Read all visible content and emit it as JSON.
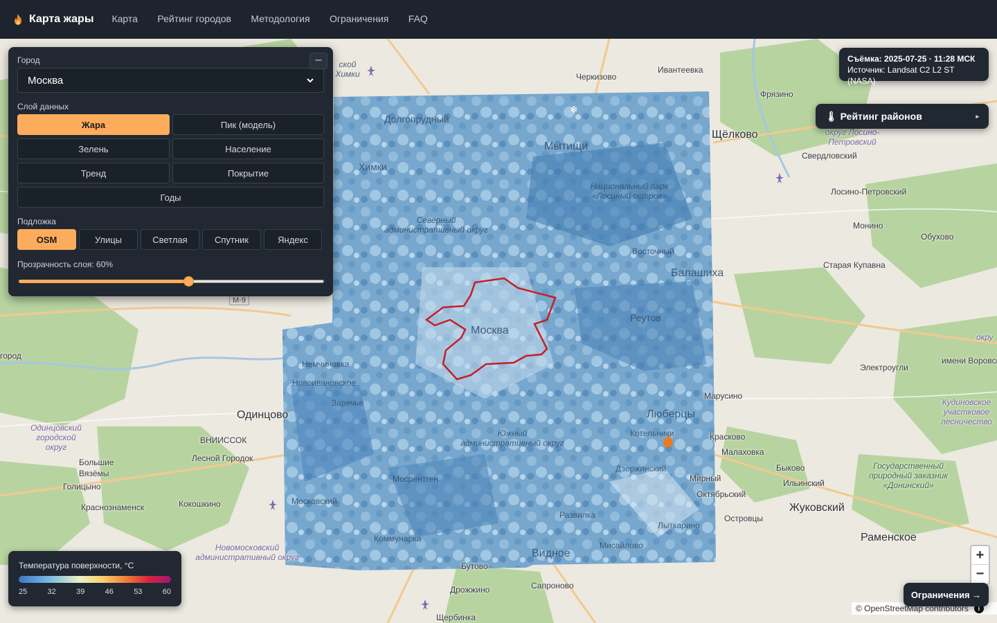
{
  "app": {
    "title": "Карта жары"
  },
  "nav": {
    "items": [
      "Карта",
      "Рейтинг городов",
      "Методология",
      "Ограничения",
      "FAQ"
    ]
  },
  "panel": {
    "city_label": "Город",
    "city_value": "Москва",
    "layer_label": "Слой данных",
    "layers": [
      "Жара",
      "Пик (модель)",
      "Зелень",
      "Население",
      "Тренд",
      "Покрытие",
      "Годы"
    ],
    "active_layer": "Жара",
    "basemap_label": "Подложка",
    "basemaps": [
      "OSM",
      "Улицы",
      "Светлая",
      "Спутник",
      "Яндекс"
    ],
    "active_basemap": "OSM",
    "opacity_label": "Прозрачность слоя: 60%",
    "opacity_value": 0.6,
    "collapse_glyph": "–"
  },
  "info": {
    "capture_label": "Съёмка:",
    "capture_value": "2025-07-25 · 11:28 МСК",
    "source_label": "Источник:",
    "source_value": "Landsat C2 L2 ST (NASA)"
  },
  "ranking": {
    "label": "🌡 Рейтинг районов",
    "arrow": "▸"
  },
  "legend": {
    "title": "Температура поверхности, °C",
    "ticks": [
      "25",
      "32",
      "39",
      "46",
      "53",
      "60"
    ]
  },
  "zoom": {
    "in": "+",
    "out": "−"
  },
  "limits_button": "Ограничения →",
  "attribution": "© OpenStreetMap contributors",
  "attribution_icon": "i",
  "map_labels": {
    "moscow": "Москва",
    "mytishchi": "Мытищи",
    "khimki": "Химки",
    "dolgoprudny": "Долгопрудный",
    "shchyolkovo": "Щёлково",
    "balashikha": "Балашиха",
    "reutov": "Реутов",
    "odintsovo": "Одинцово",
    "lyubertsy": "Люберцы",
    "kotelniki": "Котельники",
    "dzerzhinsky": "Дзержинский",
    "vidnoe": "Видное",
    "zhukovsky": "Жуковский",
    "ramenskoe": "Раменское",
    "cherkizovo": "Черкизово",
    "ivanteevka": "Ивантеевка",
    "fryazino": "Фрязино",
    "sverdlovsky": "Свердловский",
    "losino": "Лосино-Петровский",
    "monino": "Монино",
    "obukhovo": "Обухово",
    "kupavna": "Старая Купавна",
    "elektrougli": "Электроугли",
    "vorovskogo": "имени Воровского",
    "marusino": "Марусино",
    "kraskovo": "Красково",
    "malakhovka": "Малаховка",
    "bykovo": "Быково",
    "ilinsky": "Ильинский",
    "mirny": "Мирный",
    "oktyabrsky": "Октябрьский",
    "ostrovtsy": "Островцы",
    "lytkarino": "Лыткарино",
    "razvilka": "Развилка",
    "misailovo": "Мисайлово",
    "butovo": "Бутово",
    "drozhzhino": "Дрожжино",
    "saprono": "Сапроново",
    "shcherbinka": "Щербинка",
    "kommunarka": "Коммунарка",
    "mosrentgen": "Мосрентген",
    "moskovsky": "Московский",
    "nemchinovka": "Немчиновка",
    "novoivankovskoe": "Новоивановское",
    "zarechye": "Заречье",
    "vniissok": "ВНИИССОК",
    "lesnoy": "Лесной Городок",
    "bvyazemy": "Большие Вязёмы",
    "golitsyno": "Голицыно",
    "krasnoznamensk": "Краснознаменск",
    "kokoshkino": "Кокошкино",
    "vostochny": "Восточный",
    "gorod": "город",
    "okrug_right": "окру",
    "m9": "М-9",
    "park_losiny": "Национальный парк «Лосиный остров»",
    "ao_north": "Северный административный округ",
    "ao_south": "Южный административный округ",
    "ao_novomoskovsky": "Новомосковский административный округ",
    "ao_odintsovo": "Одинцовский городской округ",
    "losino_okrug": "округ Лосино-Петровский",
    "kudinovo": "Кудиновское участковое лесничество",
    "domodedovo_reserve": "Государственный природный заказник «Донинский»",
    "khimki_ao": "ской Химки"
  }
}
